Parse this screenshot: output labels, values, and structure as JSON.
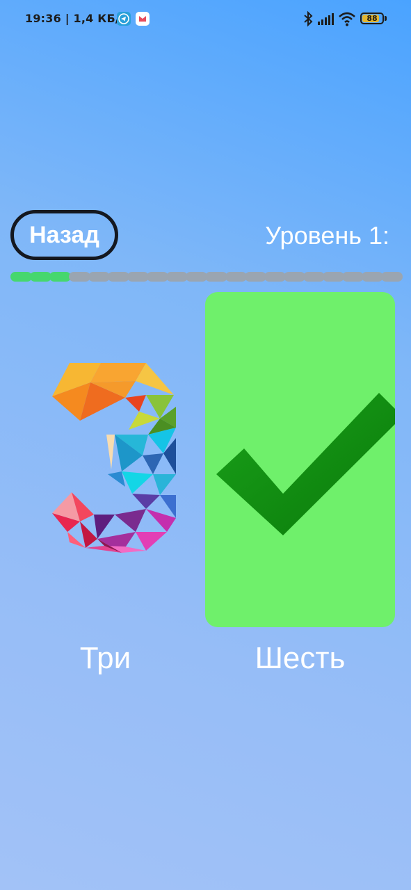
{
  "status_bar": {
    "time": "19:36 | 1,4 КБ/с",
    "battery": "88",
    "battery_level": 0.88,
    "icons": [
      "telegram-icon",
      "notification-app-icon",
      "bluetooth-icon",
      "signal-icon",
      "wifi-icon",
      "battery-icon"
    ]
  },
  "header": {
    "back_label": "Назад",
    "level_label": "Уровень 1:"
  },
  "progress": {
    "completed": 3,
    "total": 20,
    "done_color": "#46d76e",
    "pending_color": "#9aa5b1"
  },
  "cards": [
    {
      "label": "Три",
      "image": "number-three-icon",
      "selected": false
    },
    {
      "label": "Шесть",
      "image": "checkmark-icon",
      "selected": true,
      "background": "#6ff06b"
    }
  ]
}
